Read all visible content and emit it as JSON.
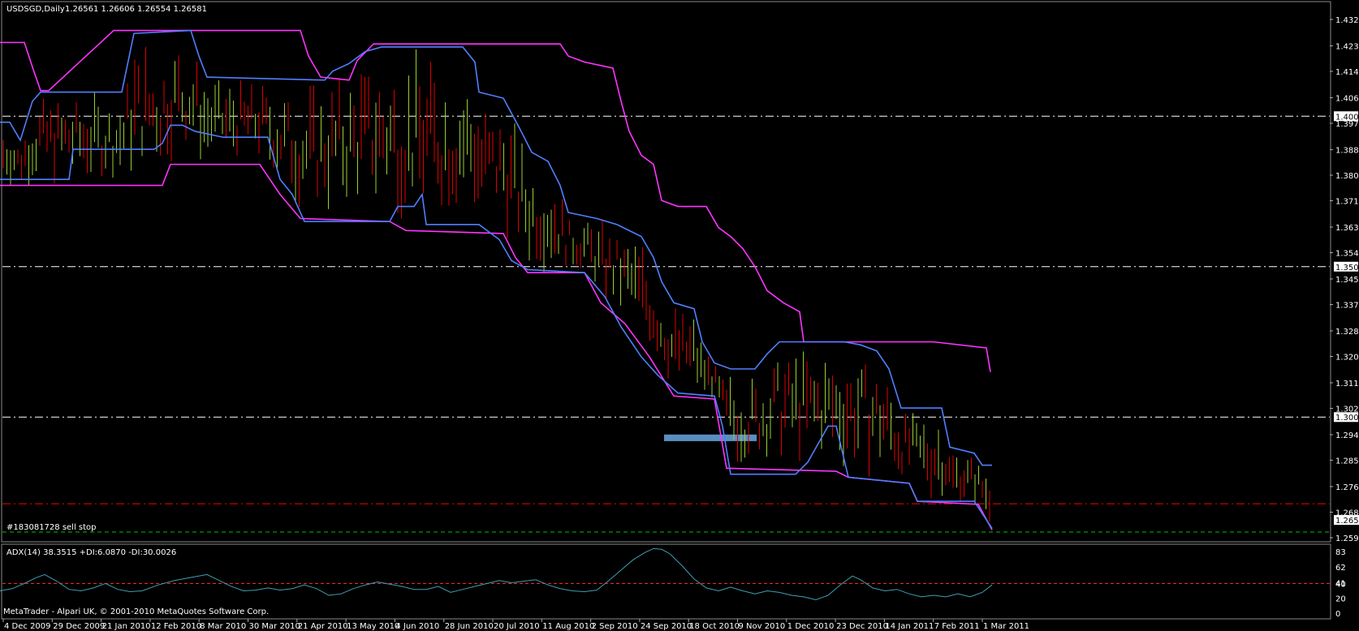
{
  "chart_data": [
    {
      "type": "candlestick",
      "title": "USDSGD,Daily",
      "ohlc_header": "1.26561 1.26606 1.26554 1.26581",
      "current_price": 1.26581,
      "current_price_label": "1.26581",
      "ylim": [
        1.2599,
        1.4325
      ],
      "y_ticks": [
        "1.43215",
        "1.42340",
        "1.41490",
        "1.40615",
        "1.39765",
        "1.38890",
        "1.38040",
        "1.37190",
        "1.36315",
        "1.35465",
        "1.34590",
        "1.33740",
        "1.32865",
        "1.32015",
        "1.31140",
        "1.30290",
        "1.29415",
        "1.28565",
        "1.27690",
        "1.26840",
        "1.25990"
      ],
      "x_labels": [
        "4 Dec 2009",
        "29 Dec 2009",
        "21 Jan 2010",
        "12 Feb 2010",
        "8 Mar 2010",
        "30 Mar 2010",
        "21 Apr 2010",
        "13 May 2010",
        "4 Jun 2010",
        "28 Jun 2010",
        "20 Jul 2010",
        "11 Aug 2010",
        "2 Sep 2010",
        "24 Sep 2010",
        "18 Oct 2010",
        "9 Nov 2010",
        "1 Dec 2010",
        "23 Dec 2010",
        "14 Jan 2011",
        "7 Feb 2011",
        "1 Mar 2011"
      ],
      "levels": [
        {
          "value": 1.4,
          "label": "1.40000",
          "color": "#ffffff",
          "style": "dash-dot"
        },
        {
          "value": 1.35,
          "label": "1.35000",
          "color": "#ffffff",
          "style": "dash-dot"
        },
        {
          "value": 1.3,
          "label": "1.30000",
          "color": "#ffffff",
          "style": "dash-dot"
        },
        {
          "value": 1.2712,
          "label": "",
          "color": "#ff0000",
          "style": "dash-dot"
        },
        {
          "value": 1.2618,
          "label": "",
          "color": "#00c000",
          "style": "dash"
        }
      ],
      "order_label": "#183081728 sell stop",
      "bull_color": "#9acd32",
      "bear_color": "#dd0000",
      "upper_channel_color": "#ff33ff",
      "inner_channel_color": "#4f7fff",
      "upper_channel": [
        [
          0,
          1.4245
        ],
        [
          30,
          1.4245
        ],
        [
          40,
          1.4163
        ],
        [
          50,
          1.4085
        ],
        [
          60,
          1.4085
        ],
        [
          140,
          1.4285
        ],
        [
          350,
          1.4285
        ],
        [
          370,
          1.4285
        ],
        [
          380,
          1.42
        ],
        [
          395,
          1.413
        ],
        [
          430,
          1.412
        ],
        [
          440,
          1.4185
        ],
        [
          460,
          1.424
        ],
        [
          690,
          1.424
        ],
        [
          700,
          1.42
        ],
        [
          720,
          1.418
        ],
        [
          755,
          1.416
        ],
        [
          765,
          1.405
        ],
        [
          775,
          1.395
        ],
        [
          790,
          1.387
        ],
        [
          805,
          1.384
        ],
        [
          815,
          1.372
        ],
        [
          835,
          1.37
        ],
        [
          870,
          1.37
        ],
        [
          885,
          1.363
        ],
        [
          900,
          1.36
        ],
        [
          915,
          1.356
        ],
        [
          930,
          1.35
        ],
        [
          945,
          1.342
        ],
        [
          965,
          1.338
        ],
        [
          985,
          1.335
        ],
        [
          990,
          1.325
        ],
        [
          1150,
          1.325
        ],
        [
          1215,
          1.323
        ],
        [
          1220,
          1.315
        ]
      ],
      "inner_upper": [
        [
          0,
          1.398
        ],
        [
          12,
          1.398
        ],
        [
          25,
          1.392
        ],
        [
          40,
          1.405
        ],
        [
          50,
          1.408
        ],
        [
          150,
          1.408
        ],
        [
          165,
          1.4275
        ],
        [
          235,
          1.4285
        ],
        [
          245,
          1.42
        ],
        [
          255,
          1.413
        ],
        [
          400,
          1.412
        ],
        [
          410,
          1.415
        ],
        [
          430,
          1.4175
        ],
        [
          450,
          1.4215
        ],
        [
          470,
          1.423
        ],
        [
          570,
          1.423
        ],
        [
          585,
          1.418
        ],
        [
          590,
          1.408
        ],
        [
          620,
          1.406
        ],
        [
          640,
          1.396
        ],
        [
          655,
          1.388
        ],
        [
          675,
          1.385
        ],
        [
          690,
          1.377
        ],
        [
          700,
          1.368
        ],
        [
          735,
          1.366
        ],
        [
          760,
          1.364
        ],
        [
          790,
          1.36
        ],
        [
          805,
          1.353
        ],
        [
          815,
          1.345
        ],
        [
          830,
          1.338
        ],
        [
          855,
          1.336
        ],
        [
          865,
          1.325
        ],
        [
          880,
          1.318
        ],
        [
          900,
          1.316
        ],
        [
          930,
          1.316
        ],
        [
          945,
          1.321
        ],
        [
          960,
          1.325
        ],
        [
          1040,
          1.325
        ],
        [
          1060,
          1.324
        ],
        [
          1080,
          1.322
        ],
        [
          1095,
          1.316
        ],
        [
          1110,
          1.303
        ],
        [
          1160,
          1.303
        ],
        [
          1170,
          1.29
        ],
        [
          1200,
          1.288
        ],
        [
          1210,
          1.284
        ],
        [
          1222,
          1.284
        ]
      ],
      "inner_lower": [
        [
          0,
          1.379
        ],
        [
          85,
          1.379
        ],
        [
          90,
          1.389
        ],
        [
          110,
          1.389
        ],
        [
          190,
          1.389
        ],
        [
          200,
          1.391
        ],
        [
          210,
          1.397
        ],
        [
          225,
          1.397
        ],
        [
          240,
          1.395
        ],
        [
          275,
          1.393
        ],
        [
          330,
          1.393
        ],
        [
          345,
          1.379
        ],
        [
          360,
          1.374
        ],
        [
          375,
          1.365
        ],
        [
          480,
          1.365
        ],
        [
          490,
          1.37
        ],
        [
          510,
          1.37
        ],
        [
          520,
          1.374
        ],
        [
          525,
          1.364
        ],
        [
          590,
          1.364
        ],
        [
          615,
          1.359
        ],
        [
          630,
          1.352
        ],
        [
          650,
          1.349
        ],
        [
          720,
          1.348
        ],
        [
          745,
          1.34
        ],
        [
          765,
          1.33
        ],
        [
          790,
          1.32
        ],
        [
          810,
          1.314
        ],
        [
          835,
          1.308
        ],
        [
          880,
          1.307
        ],
        [
          890,
          1.297
        ],
        [
          900,
          1.281
        ],
        [
          980,
          1.281
        ],
        [
          995,
          1.285
        ],
        [
          1020,
          1.297
        ],
        [
          1030,
          1.297
        ],
        [
          1045,
          1.28
        ],
        [
          1120,
          1.278
        ],
        [
          1130,
          1.272
        ],
        [
          1200,
          1.272
        ],
        [
          1222,
          1.263
        ]
      ],
      "lower_channel": [
        [
          0,
          1.377
        ],
        [
          200,
          1.377
        ],
        [
          210,
          1.384
        ],
        [
          320,
          1.384
        ],
        [
          345,
          1.374
        ],
        [
          370,
          1.366
        ],
        [
          480,
          1.365
        ],
        [
          500,
          1.362
        ],
        [
          620,
          1.361
        ],
        [
          635,
          1.353
        ],
        [
          650,
          1.348
        ],
        [
          720,
          1.348
        ],
        [
          740,
          1.338
        ],
        [
          770,
          1.331
        ],
        [
          800,
          1.32
        ],
        [
          830,
          1.307
        ],
        [
          880,
          1.306
        ],
        [
          895,
          1.283
        ],
        [
          1030,
          1.282
        ],
        [
          1045,
          1.28
        ],
        [
          1120,
          1.278
        ],
        [
          1130,
          1.272
        ],
        [
          1205,
          1.271
        ],
        [
          1222,
          1.2625
        ]
      ],
      "highlight_zone": {
        "from_x": 818,
        "to_x": 932,
        "low": 1.292,
        "high": 1.2942,
        "color": "#5b8ec0"
      }
    },
    {
      "type": "line",
      "title": "ADX(14) 38.3515 +DI:6.0870 -DI:30.0026",
      "ylim": [
        0,
        90
      ],
      "y_ticks": [
        "83",
        "62",
        "41",
        "40",
        "20",
        "0"
      ],
      "reference_level": {
        "value": 40,
        "color": "#ff3333",
        "style": "dash"
      },
      "line_color": "#3f9fb0",
      "series": [
        [
          0,
          30
        ],
        [
          15,
          33
        ],
        [
          30,
          40
        ],
        [
          45,
          48
        ],
        [
          55,
          52
        ],
        [
          70,
          43
        ],
        [
          85,
          32
        ],
        [
          100,
          30
        ],
        [
          115,
          34
        ],
        [
          130,
          40
        ],
        [
          145,
          32
        ],
        [
          160,
          29
        ],
        [
          175,
          30
        ],
        [
          195,
          38
        ],
        [
          215,
          44
        ],
        [
          235,
          48
        ],
        [
          255,
          52
        ],
        [
          270,
          44
        ],
        [
          285,
          36
        ],
        [
          300,
          30
        ],
        [
          315,
          31
        ],
        [
          330,
          34
        ],
        [
          345,
          31
        ],
        [
          360,
          33
        ],
        [
          375,
          38
        ],
        [
          390,
          33
        ],
        [
          405,
          24
        ],
        [
          420,
          26
        ],
        [
          435,
          33
        ],
        [
          450,
          38
        ],
        [
          465,
          42
        ],
        [
          480,
          39
        ],
        [
          495,
          36
        ],
        [
          510,
          32
        ],
        [
          525,
          32
        ],
        [
          540,
          36
        ],
        [
          555,
          28
        ],
        [
          570,
          32
        ],
        [
          585,
          36
        ],
        [
          600,
          40
        ],
        [
          615,
          44
        ],
        [
          630,
          41
        ],
        [
          645,
          43
        ],
        [
          660,
          45
        ],
        [
          675,
          38
        ],
        [
          690,
          33
        ],
        [
          705,
          30
        ],
        [
          720,
          29
        ],
        [
          735,
          31
        ],
        [
          750,
          44
        ],
        [
          765,
          58
        ],
        [
          780,
          72
        ],
        [
          795,
          82
        ],
        [
          805,
          87
        ],
        [
          815,
          86
        ],
        [
          825,
          80
        ],
        [
          840,
          64
        ],
        [
          855,
          46
        ],
        [
          870,
          34
        ],
        [
          885,
          30
        ],
        [
          900,
          35
        ],
        [
          915,
          30
        ],
        [
          930,
          26
        ],
        [
          945,
          30
        ],
        [
          960,
          28
        ],
        [
          975,
          24
        ],
        [
          990,
          22
        ],
        [
          1005,
          18
        ],
        [
          1020,
          24
        ],
        [
          1035,
          38
        ],
        [
          1050,
          50
        ],
        [
          1060,
          45
        ],
        [
          1075,
          34
        ],
        [
          1090,
          30
        ],
        [
          1105,
          32
        ],
        [
          1120,
          26
        ],
        [
          1135,
          22
        ],
        [
          1150,
          24
        ],
        [
          1165,
          22
        ],
        [
          1180,
          26
        ],
        [
          1195,
          22
        ],
        [
          1210,
          28
        ],
        [
          1222,
          38
        ]
      ]
    }
  ],
  "footer": {
    "copyright": "MetaTrader - Alpari UK, © 2001-2010 MetaQuotes Software Corp."
  }
}
